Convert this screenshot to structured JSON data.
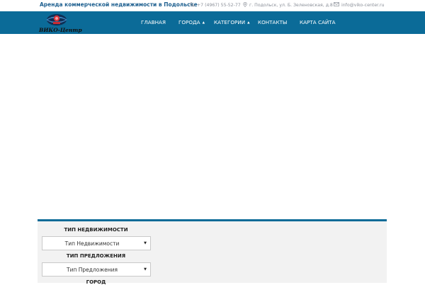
{
  "topbar": {
    "tagline": "Аренда коммерческой недвижимости в Подольске",
    "phone": "+7 (4967) 55-52-77",
    "address": "г. Подольск, ул. Б. Зеленовская, д.8",
    "email": "info@viko-center.ru"
  },
  "logo": {
    "text": "ВИКО-Центр"
  },
  "nav": {
    "items": [
      {
        "label": "ГЛАВНАЯ"
      },
      {
        "label": "ГОРОДА",
        "caret": "▲"
      },
      {
        "label": "КАТЕГОРИИ",
        "caret": "▲"
      },
      {
        "label": "КОНТАКТЫ"
      },
      {
        "label": "КАРТА САЙТА"
      }
    ]
  },
  "search": {
    "property_type_label": "ТИП НЕДВИЖИМОСТИ",
    "property_type_value": "Тип Недвижимости",
    "offer_type_label": "ТИП ПРЕДЛОЖЕНИЯ",
    "offer_type_value": "Тип Предложения",
    "city_label": "ГОРОД"
  },
  "colors": {
    "brand": "#0b6b98",
    "tagline": "#1d5f8f",
    "panel": "#f2f2f2"
  }
}
